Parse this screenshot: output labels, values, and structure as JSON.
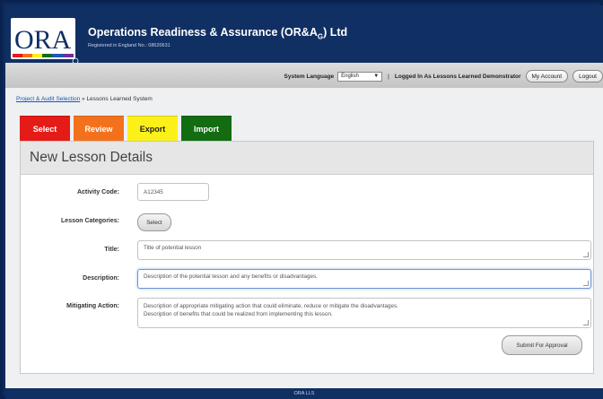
{
  "header": {
    "company_name": "Operations Readiness & Assurance (OR&A",
    "company_sub": "G",
    "company_suffix": ") Ltd",
    "registration": "Registered in England No.: 08620631",
    "logo_text": "ORA"
  },
  "toolbar": {
    "language_label": "System Language",
    "language_value": "English",
    "separator": "|",
    "logged_in": "Logged In As Lessons Learned Demonstrator",
    "my_account": "My Account",
    "logout": "Logout"
  },
  "breadcrumb": {
    "link": "Project & Audit Selection",
    "separator": "»",
    "current": "Lessons Learned System"
  },
  "tabs": [
    "Select",
    "Review",
    "Export",
    "Import"
  ],
  "form": {
    "title": "New Lesson Details",
    "activity_code_label": "Activity Code:",
    "activity_code_value": "A12345",
    "categories_label": "Lesson Categories:",
    "categories_button": "Select",
    "title_label": "Title:",
    "title_value": "Title of potential lesson",
    "description_label": "Description:",
    "description_value": "Description of the potential lesson and any benefits or disadvantages.",
    "mitigating_label": "Mitigating Action:",
    "mitigating_line1": "Description of appropriate mitigating action that could eliminate, reduce or mitigate the disadvantages.",
    "mitigating_line2": "Description of benefits that could be realized from implementing this lesson.",
    "submit_button": "Submit For Approval"
  },
  "footer": {
    "text": "ORA LLS"
  },
  "colors": {
    "tab_select": "#e41b17",
    "tab_review": "#f4711c",
    "tab_export": "#fbf118",
    "tab_import": "#136b12",
    "banner": "#102f63"
  }
}
